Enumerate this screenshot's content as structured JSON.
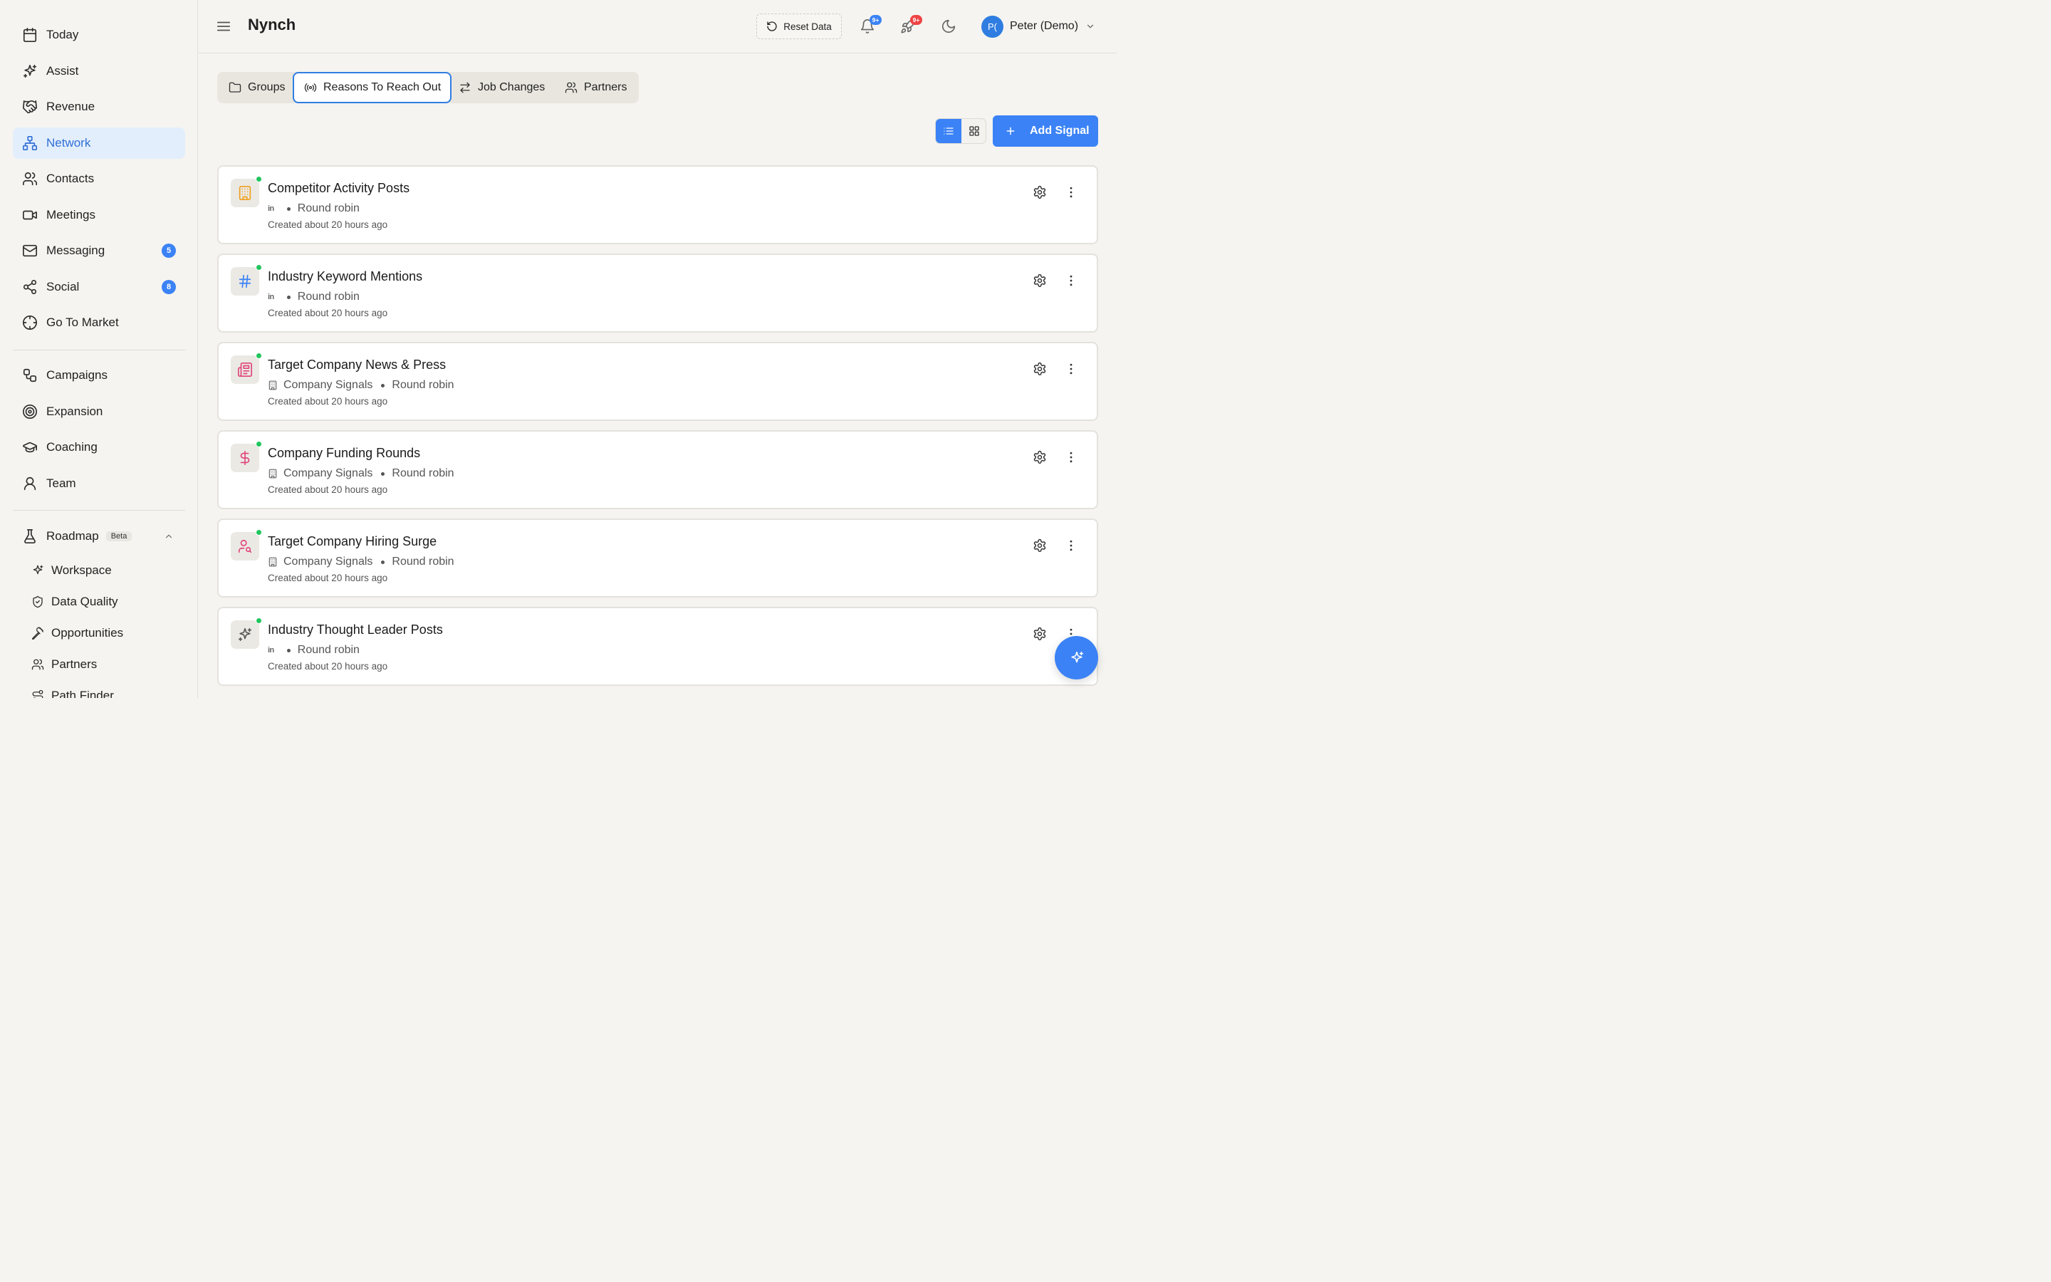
{
  "app": {
    "title": "Nynch"
  },
  "sidebar": {
    "items": [
      {
        "label": "Today",
        "icon": "calendar-icon"
      },
      {
        "label": "Assist",
        "icon": "sparkles-icon"
      },
      {
        "label": "Revenue",
        "icon": "handshake-icon"
      },
      {
        "label": "Network",
        "icon": "network-icon",
        "active": true
      },
      {
        "label": "Contacts",
        "icon": "users-icon"
      },
      {
        "label": "Meetings",
        "icon": "video-icon"
      },
      {
        "label": "Messaging",
        "icon": "mail-icon",
        "badge": "5"
      },
      {
        "label": "Social",
        "icon": "share-icon",
        "badge": "8"
      },
      {
        "label": "Go To Market",
        "icon": "crosshair-icon"
      }
    ],
    "items2": [
      {
        "label": "Campaigns",
        "icon": "workflow-icon"
      },
      {
        "label": "Expansion",
        "icon": "target-icon"
      },
      {
        "label": "Coaching",
        "icon": "graduation-cap-icon"
      },
      {
        "label": "Team",
        "icon": "user-icon"
      }
    ],
    "roadmap": {
      "label": "Roadmap",
      "badge": "Beta",
      "icon": "flask-icon"
    },
    "roadmap_items": [
      {
        "label": "Workspace",
        "icon": "sparkles-icon"
      },
      {
        "label": "Data Quality",
        "icon": "shield-check-icon"
      },
      {
        "label": "Opportunities",
        "icon": "pickaxe-icon"
      },
      {
        "label": "Partners",
        "icon": "users-icon"
      },
      {
        "label": "Path Finder",
        "icon": "route-icon"
      }
    ]
  },
  "header": {
    "reset_label": "Reset Data",
    "notifications_badge": "9+",
    "activity_badge": "9+",
    "user": {
      "initials": "P(",
      "name": "Peter (Demo)"
    }
  },
  "tabs": [
    {
      "label": "Groups",
      "icon": "folder-icon"
    },
    {
      "label": "Reasons To Reach Out",
      "icon": "broadcast-icon",
      "active": true
    },
    {
      "label": "Job Changes",
      "icon": "arrows-swap-icon"
    },
    {
      "label": "Partners",
      "icon": "users-icon"
    }
  ],
  "toolbar": {
    "add_label": "Add Signal",
    "view": "list"
  },
  "signals": [
    {
      "title": "Competitor Activity Posts",
      "source_icon": "linkedin-icon",
      "source": "",
      "assignment": "Round robin",
      "created": "Created about 20 hours ago",
      "icon": "building-icon",
      "icon_color": "#f0a020"
    },
    {
      "title": "Industry Keyword Mentions",
      "source_icon": "linkedin-icon",
      "source": "",
      "assignment": "Round robin",
      "created": "Created about 20 hours ago",
      "icon": "hash-icon",
      "icon_color": "#3b82f6"
    },
    {
      "title": "Target Company News & Press",
      "source_icon": "building-icon",
      "source": "Company Signals",
      "assignment": "Round robin",
      "created": "Created about 20 hours ago",
      "icon": "newspaper-icon",
      "icon_color": "#e0457b"
    },
    {
      "title": "Company Funding Rounds",
      "source_icon": "building-icon",
      "source": "Company Signals",
      "assignment": "Round robin",
      "created": "Created about 20 hours ago",
      "icon": "dollar-icon",
      "icon_color": "#e0457b"
    },
    {
      "title": "Target Company Hiring Surge",
      "source_icon": "building-icon",
      "source": "Company Signals",
      "assignment": "Round robin",
      "created": "Created about 20 hours ago",
      "icon": "user-search-icon",
      "icon_color": "#e0457b"
    },
    {
      "title": "Industry Thought Leader Posts",
      "source_icon": "linkedin-icon",
      "source": "",
      "assignment": "Round robin",
      "created": "Created about 20 hours ago",
      "icon": "sparkles-icon",
      "icon_color": "#555555"
    }
  ],
  "colors": {
    "accent": "#3b82f6",
    "status_active": "#22c55e",
    "badge_red": "#ef4444"
  }
}
